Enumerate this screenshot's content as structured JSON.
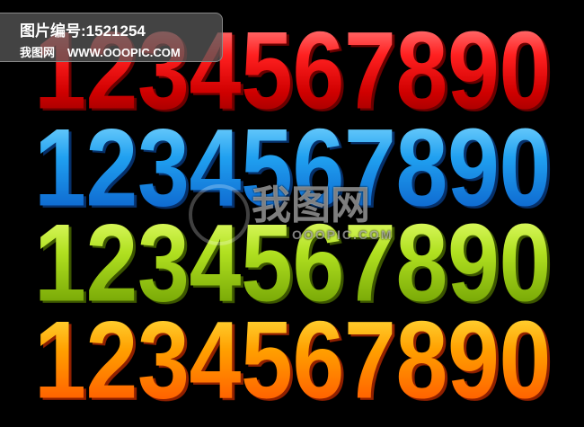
{
  "label": {
    "id_prefix": "图片编号:",
    "id_value": "1521254",
    "site_cn": "我图网",
    "site_url": "WWW.OOOPIC.COM"
  },
  "watermark": {
    "cn": "我图网",
    "url": "OOOPIC.COM"
  },
  "digits": [
    "1",
    "2",
    "3",
    "4",
    "5",
    "6",
    "7",
    "8",
    "9",
    "0"
  ],
  "rows": [
    {
      "name": "red",
      "color": "#ff2020"
    },
    {
      "name": "blue",
      "color": "#20a0f0"
    },
    {
      "name": "green",
      "color": "#b0e020"
    },
    {
      "name": "orange",
      "color": "#ffa000"
    }
  ]
}
